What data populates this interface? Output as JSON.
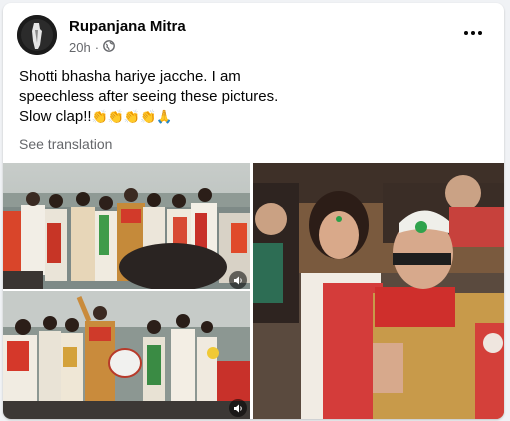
{
  "post": {
    "author": "Rupanjana Mitra",
    "time": "20h",
    "separator": "·",
    "audience_icon": "globe-icon",
    "more_icon": "more-options-icon",
    "text_lines": [
      "Shotti bhasha hariye jacche. I am",
      "speechless after seeing these pictures.",
      "Slow clap!!"
    ],
    "emojis": "👏👏👏👏🙏",
    "see_translation": "See translation"
  },
  "photos": {
    "sound_icon": "speaker-icon",
    "items": [
      "photo-top-left",
      "photo-bottom-left",
      "photo-right"
    ]
  },
  "colors": {
    "text_primary": "#050505",
    "text_secondary": "#65676b",
    "card_bg": "#ffffff",
    "page_bg": "#f0f2f5"
  }
}
